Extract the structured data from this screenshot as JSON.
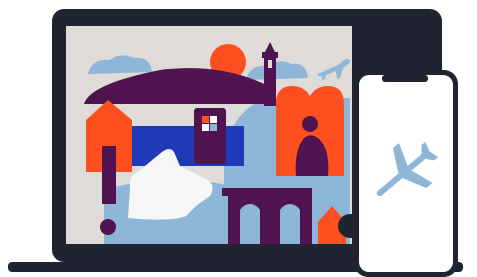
{
  "illustration": {
    "devices": [
      "laptop",
      "smartphone"
    ],
    "icons": [
      "airplane-icon",
      "small-airplane-icon",
      "exclamation-mark-icon",
      "sun-icon",
      "bridge-icon",
      "person-icon"
    ]
  },
  "colors": {
    "device_frame": "#1f2430",
    "screen_background": "#dedbd8",
    "purple": "#4f1450",
    "orange_red": "#ff4f1f",
    "light_blue": "#8eb6d8",
    "royal_blue": "#1f3ab8",
    "white": "#ffffff"
  }
}
